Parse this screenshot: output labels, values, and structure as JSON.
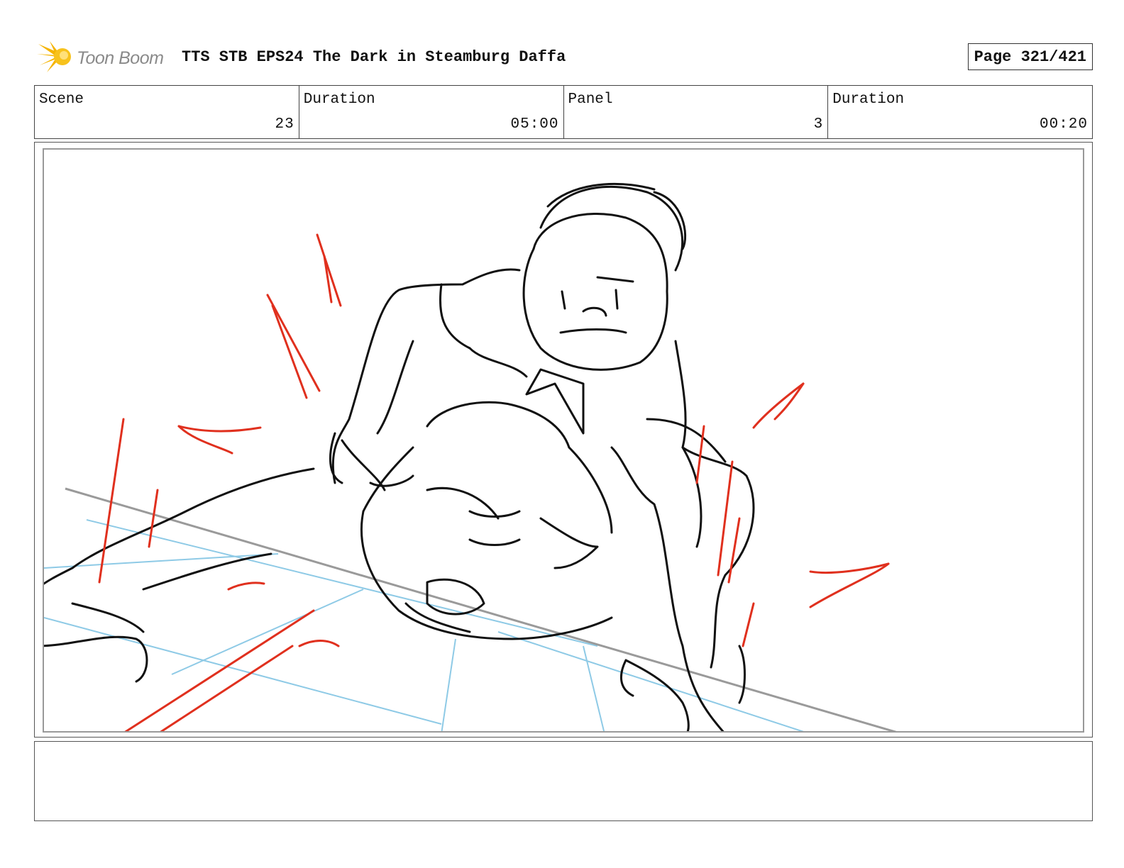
{
  "header": {
    "logo_text": "Toon Boom",
    "title": "TTS STB EPS24 The Dark in Steamburg Daffa",
    "page": "Page 321/421"
  },
  "info": {
    "scene_label": "Scene",
    "scene_value": "23",
    "scene_duration_label": "Duration",
    "scene_duration_value": "05:00",
    "panel_label": "Panel",
    "panel_value": "3",
    "panel_duration_label": "Duration",
    "panel_duration_value": "00:20"
  },
  "colors": {
    "logo_yellow": "#f5b400",
    "line_black": "#111111",
    "accent_red": "#e0301e",
    "guide_blue": "#8ecae6",
    "guide_gray": "#9a9a9a"
  }
}
